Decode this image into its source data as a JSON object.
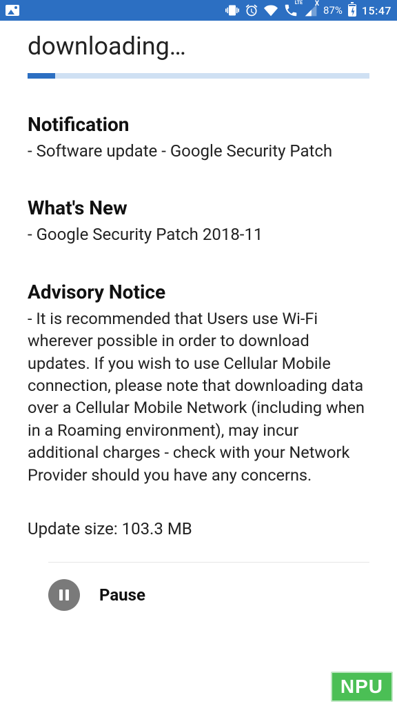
{
  "status": {
    "battery_pct": "87%",
    "time": "15:47",
    "lte_label": "LTE",
    "x_label": "X"
  },
  "header": {
    "title": "downloading…"
  },
  "progress": {
    "percent": 8
  },
  "notification": {
    "heading": "Notification",
    "body": "- Software update - Google Security Patch"
  },
  "whats_new": {
    "heading": "What's New",
    "body": "- Google Security Patch 2018-11"
  },
  "advisory": {
    "heading": "Advisory Notice",
    "body": "- It is recommended that Users use Wi-Fi wherever possible in order to download updates. If you wish to use Cellular Mobile connection, please note that downloading data over a Cellular Mobile Network (including when in a Roaming environment), may incur additional charges - check with your Network Provider should you have any concerns."
  },
  "update_size": "Update size: 103.3 MB",
  "actions": {
    "pause_label": "Pause"
  },
  "watermark": "NPU"
}
